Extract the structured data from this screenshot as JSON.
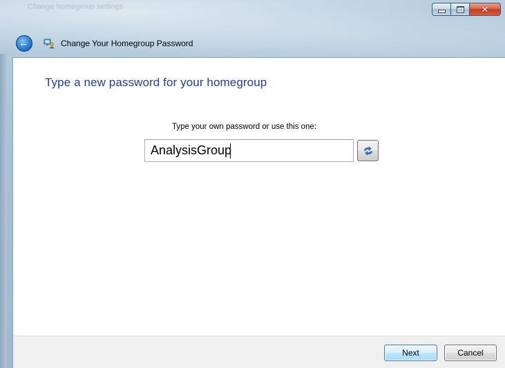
{
  "window": {
    "title": "Change Your Homegroup Password",
    "background_title": "Change homegroup settings"
  },
  "nav": {
    "back_icon": "back-arrow-icon",
    "homegroup_icon": "homegroup-icon"
  },
  "main": {
    "heading": "Type a new password for your homegroup",
    "instruction": "Type your own password or use this one:",
    "password_value": "AnalysisGroup",
    "refresh_icon": "refresh-arrows-icon"
  },
  "buttons": {
    "next": "Next",
    "cancel": "Cancel"
  },
  "colors": {
    "heading": "#1e3f9a",
    "frame": "#a7c1d7",
    "close_button": "#c43d1e",
    "command_bar": "#f0f0f0"
  }
}
